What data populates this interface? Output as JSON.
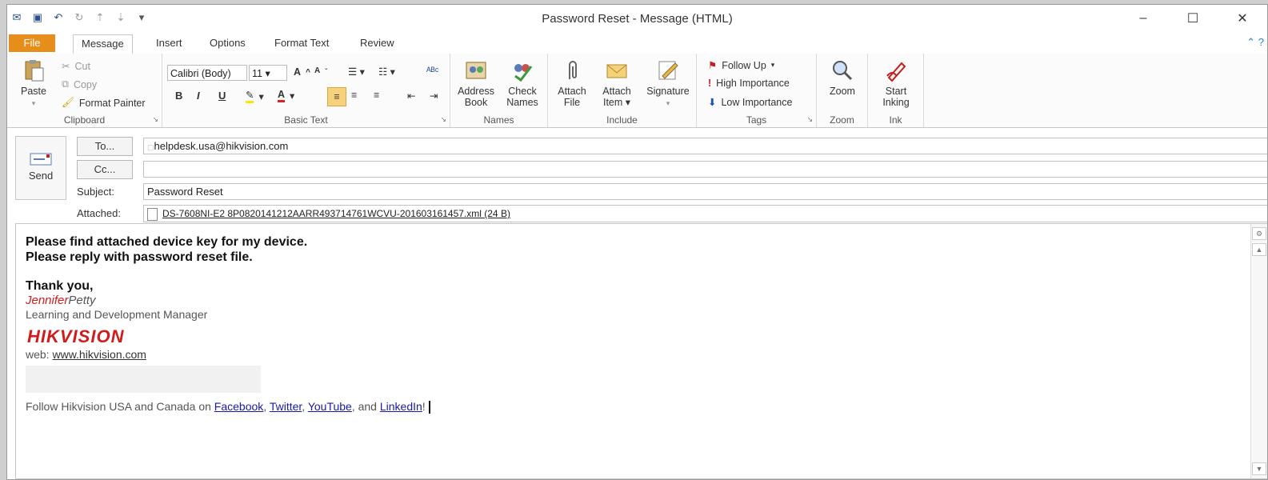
{
  "window": {
    "title": "Password Reset  - Message (HTML)",
    "controls": {
      "minimize": "–",
      "maximize": "☐",
      "close": "✕"
    }
  },
  "qat_icons": [
    "mail-icon",
    "save-icon",
    "undo-icon",
    "redo-icon",
    "up-icon",
    "down-icon",
    "customize-icon"
  ],
  "tabs": [
    {
      "label": "File"
    },
    {
      "label": "Message"
    },
    {
      "label": "Insert"
    },
    {
      "label": "Options"
    },
    {
      "label": "Format Text"
    },
    {
      "label": "Review"
    }
  ],
  "ribbon": {
    "clipboard": {
      "group": "Clipboard",
      "paste": "Paste",
      "cut": "Cut",
      "copy": "Copy",
      "format_painter": "Format Painter"
    },
    "basic_text": {
      "group": "Basic Text",
      "font": "Calibri (Body)",
      "size": "11",
      "bold": "B",
      "italic": "I",
      "underline": "U"
    },
    "names": {
      "group": "Names",
      "address_book_1": "Address",
      "address_book_2": "Book",
      "check_names_1": "Check",
      "check_names_2": "Names"
    },
    "include": {
      "group": "Include",
      "attach_file_1": "Attach",
      "attach_file_2": "File",
      "attach_item_1": "Attach",
      "attach_item_2": "Item ▾",
      "signature": "Signature"
    },
    "tags": {
      "group": "Tags",
      "follow_up": "Follow Up",
      "high_importance": "High Importance",
      "low_importance": "Low Importance"
    },
    "zoom": {
      "group": "Zoom",
      "zoom": "Zoom"
    },
    "ink": {
      "group": "Ink",
      "start_1": "Start",
      "start_2": "Inking"
    }
  },
  "header": {
    "send": "Send",
    "to_button": "To...",
    "cc_button": "Cc...",
    "subject_label": "Subject:",
    "attached_label": "Attached:",
    "to_value": "helpdesk.usa@hikvision.com",
    "cc_value": "",
    "subject_value": "Password Reset",
    "attachment": "DS-7608NI-E2 8P0820141212AARR493714761WCVU-201603161457.xml (24 B)"
  },
  "body": {
    "line1": "Please find attached device key for my device.",
    "line2": "Please reply with password reset file.",
    "thanks": "Thank you,",
    "first_name": "Jennifer",
    "last_name": "Petty",
    "job_title": "Learning and Development Manager",
    "logo": "HIKVISION",
    "web_label": "web:",
    "web_link": "www.hikvision.com",
    "follow_text": "Follow Hikvision USA and Canada on",
    "facebook": "Facebook",
    "comma1": ",",
    "twitter": "Twitter",
    "comma2": ",",
    "youtube": "YouTube",
    "and_text": ", and",
    "linkedin": "LinkedIn",
    "exclaim": "!"
  }
}
